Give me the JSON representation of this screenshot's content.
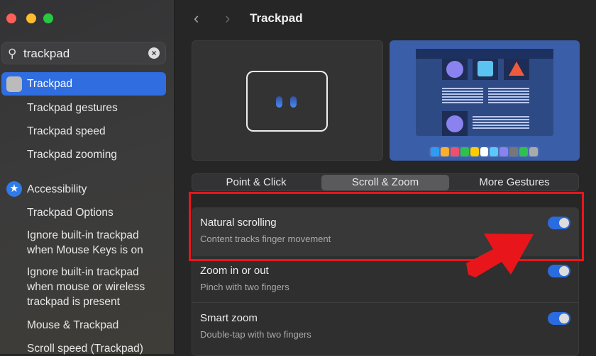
{
  "window": {
    "title": "Trackpad",
    "back_icon": "chevron-left",
    "forward_icon": "chevron-right"
  },
  "sidebar": {
    "search": {
      "value": "trackpad",
      "icon": "search-icon",
      "clear_icon": "clear-icon"
    },
    "items": [
      {
        "label": "Trackpad",
        "selected": true
      },
      {
        "label": "Trackpad gestures"
      },
      {
        "label": "Trackpad speed"
      },
      {
        "label": "Trackpad zooming"
      },
      {
        "label": "Accessibility"
      },
      {
        "label": "Trackpad Options"
      },
      {
        "label": "Ignore built-in trackpad when Mouse Keys is on"
      },
      {
        "label": "Ignore built-in trackpad when mouse or wireless trackpad is present"
      },
      {
        "label": "Mouse & Trackpad"
      },
      {
        "label": "Scroll speed (Trackpad)"
      }
    ]
  },
  "tabs": [
    {
      "label": "Point & Click"
    },
    {
      "label": "Scroll & Zoom",
      "selected": true
    },
    {
      "label": "More Gestures"
    }
  ],
  "settings": [
    {
      "label": "Natural scrolling",
      "description": "Content tracks finger movement",
      "enabled": true
    },
    {
      "label": "Zoom in or out",
      "description": "Pinch with two fingers",
      "enabled": true
    },
    {
      "label": "Smart zoom",
      "description": "Double-tap with two fingers",
      "enabled": true
    }
  ],
  "colors": {
    "accent": "#2f6de1",
    "highlight": "#e8161b"
  }
}
